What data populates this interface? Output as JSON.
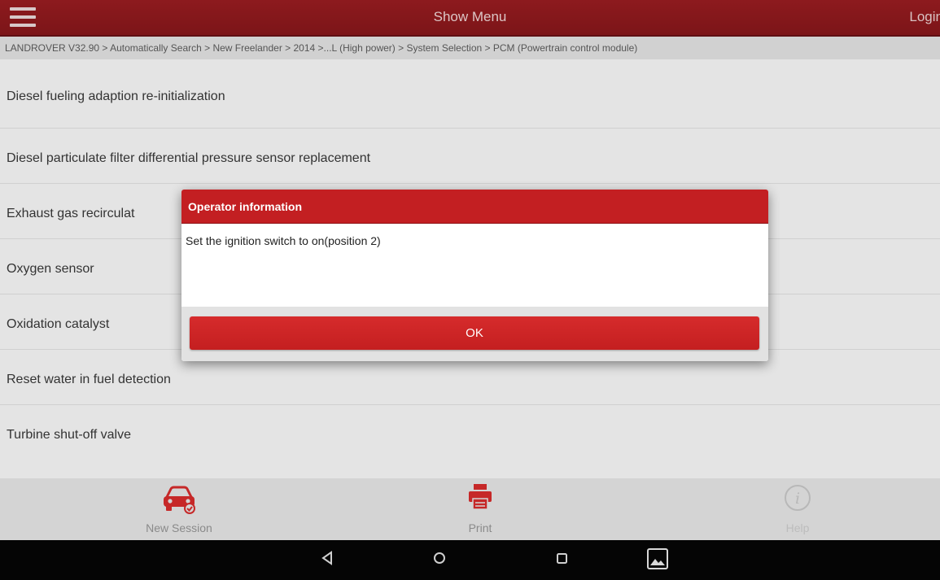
{
  "header": {
    "title": "Show Menu",
    "login_label": "Login"
  },
  "breadcrumb": "LANDROVER V32.90 > Automatically Search > New Freelander > 2014 >...L (High power) > System Selection > PCM (Powertrain control module)",
  "functions": [
    "Diesel fueling adaption re-initialization",
    "Diesel particulate filter differential pressure sensor replacement",
    "Exhaust gas recirculat",
    "Oxygen sensor",
    "Oxidation catalyst",
    "Reset water in fuel detection",
    "Turbine shut-off valve"
  ],
  "dialog": {
    "title": "Operator information",
    "message": "Set the ignition switch to on(position 2)",
    "ok_label": "OK"
  },
  "toolbar": {
    "new_session_label": "New Session",
    "print_label": "Print",
    "help_label": "Help"
  },
  "icons": {
    "menu": "hamburger-icon",
    "new_session": "car-icon",
    "print": "printer-icon",
    "help": "info-icon",
    "nav_back": "back-triangle-icon",
    "nav_home": "home-circle-icon",
    "nav_recents": "recents-square-icon",
    "nav_screenshot": "gallery-icon"
  },
  "colors": {
    "header_bar": "#7c1518",
    "dialog_header": "#c31f22",
    "ok_button": "#d62b2c",
    "icon_red": "#c62828"
  }
}
